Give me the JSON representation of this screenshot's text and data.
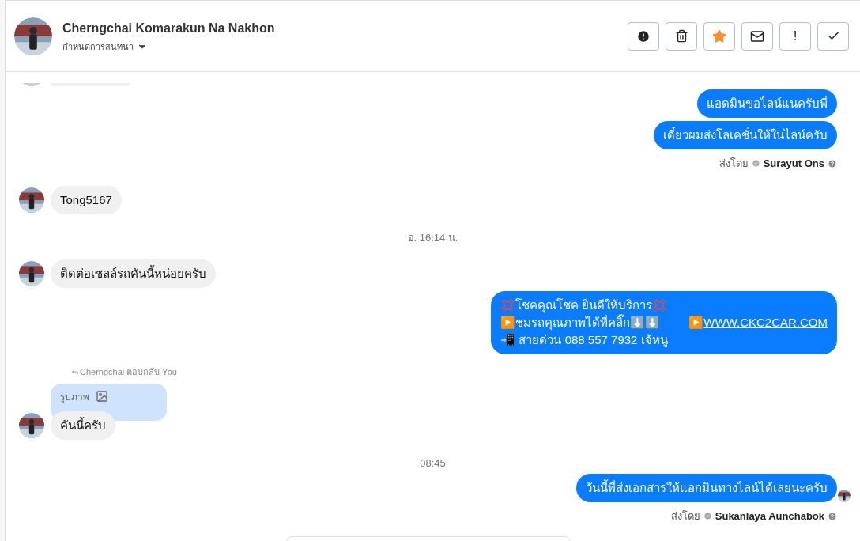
{
  "header": {
    "name": "Cherngchai Komarakun Na Nakhon",
    "subtitle": "กำหนดการสนทนา"
  },
  "actions": [
    {
      "kind": "alert"
    },
    {
      "kind": "trash"
    },
    {
      "kind": "star",
      "on": true
    },
    {
      "kind": "mail"
    },
    {
      "kind": "mark",
      "label": "!"
    },
    {
      "kind": "check"
    }
  ],
  "messages": [
    {
      "kind": "cut"
    },
    {
      "kind": "out",
      "lines": [
        "แอดมินขอไลน์แนครับพี่"
      ]
    },
    {
      "kind": "out",
      "lines": [
        "เดี๋ยวผมส่งโลเคชั่นให้ในไลน์ครับ"
      ]
    },
    {
      "kind": "sent_by",
      "label": "ส่งโดย",
      "sender": "Surayut Ons"
    },
    {
      "kind": "in",
      "text": "Tong5167"
    },
    {
      "kind": "time",
      "text": "อ. 16:14 น."
    },
    {
      "kind": "in",
      "text": "ติดต่อเซลล์รถคันนี้หน่อยครับ"
    },
    {
      "kind": "out",
      "lines": [
        "💢โชคคุณโชค ยินดีให้บริการ💢",
        "▶️ชมรถคุณภาพได้ที่คลิ๊ก⬇️⬇️"
      ],
      "link_prefix": "▶️",
      "link": "WWW.CKC2CAR.COM",
      "last": "📲 สายด่วน 088 557 7932 เจ้หนู"
    },
    {
      "kind": "reply",
      "note": "Cherngchai ตอบกลับ You",
      "quote": "รูปภาพ",
      "text": "คันนี้ครับ"
    },
    {
      "kind": "time",
      "text": "08:45"
    },
    {
      "kind": "out",
      "lines": [
        "วันนี้พี่ส่งเอกสารให้แอกมินทางไลน์ได้เลยนะครับ"
      ],
      "seen": true
    },
    {
      "kind": "sent_by",
      "label": "ส่งโดย",
      "sender": "Sukanlaya Aunchabok"
    }
  ]
}
